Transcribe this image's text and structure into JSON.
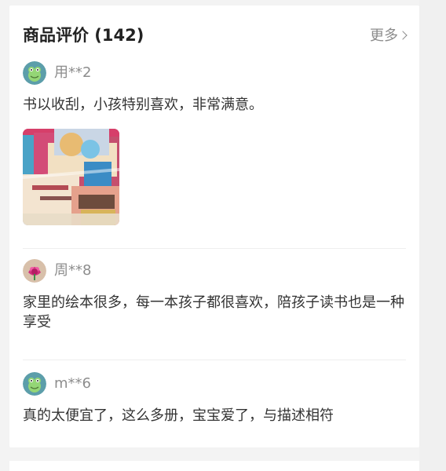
{
  "header": {
    "title": "商品评价 (142)",
    "more_label": "更多"
  },
  "reviews": [
    {
      "username": "用**2",
      "avatar_icon": "frog-avatar-icon",
      "content": "书以收刮，小孩特别喜欢，非常满意。",
      "has_image": true
    },
    {
      "username": "周**8",
      "avatar_icon": "pink-flower-avatar-icon",
      "content": "家里的绘本很多，每一本孩子都很喜欢，陪孩子读书也是一种享受",
      "has_image": false
    },
    {
      "username": "m**6",
      "avatar_icon": "frog-avatar-icon",
      "content": "真的太便宜了，这么多册，宝宝爱了，与描述相符",
      "has_image": false
    }
  ],
  "colors": {
    "background": "#f3f3f3",
    "panel": "#ffffff",
    "title": "#222222",
    "secondary_text": "#8d8d8d",
    "content_text": "#333333",
    "divider": "#eeeeee"
  }
}
